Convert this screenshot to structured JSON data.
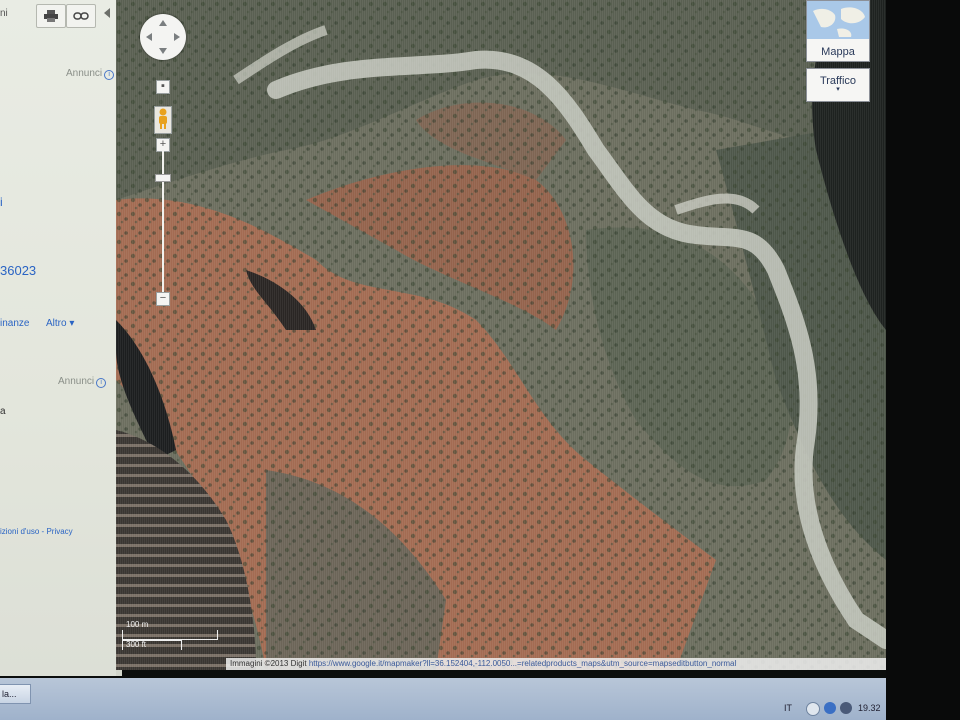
{
  "sidebar": {
    "toolbar_label": "ni",
    "print_icon": "print-icon",
    "link_icon": "link-icon",
    "ad_label_1": "Annunci",
    "heading_fragment": "i",
    "phone_fragment": "36023",
    "links": [
      "inanze",
      "Altro"
    ],
    "ad_label_2": "Annunci",
    "text_fragment": "a",
    "footer_links": "izioni d'uso - Privacy"
  },
  "map": {
    "type_buttons": {
      "map": "Mappa",
      "traffic": "Traffico"
    },
    "scale": {
      "metric": "100 m",
      "imperial": "300 ft"
    },
    "attribution": {
      "imagery": "Immagini ©2013 Digit",
      "url": "https://www.google.it/mapmaker?ll=36.152404,-112.0050...=relatedproducts_maps&utm_source=mapseditbutton_normal"
    },
    "colors": {
      "rock": "#a46f55",
      "bush": "#3f4a3b",
      "wash": "#c5c7bd",
      "shadow": "#1d1f20"
    }
  },
  "taskbar": {
    "app_label": "la...",
    "tray_lang": "IT",
    "clock": "19.32"
  }
}
